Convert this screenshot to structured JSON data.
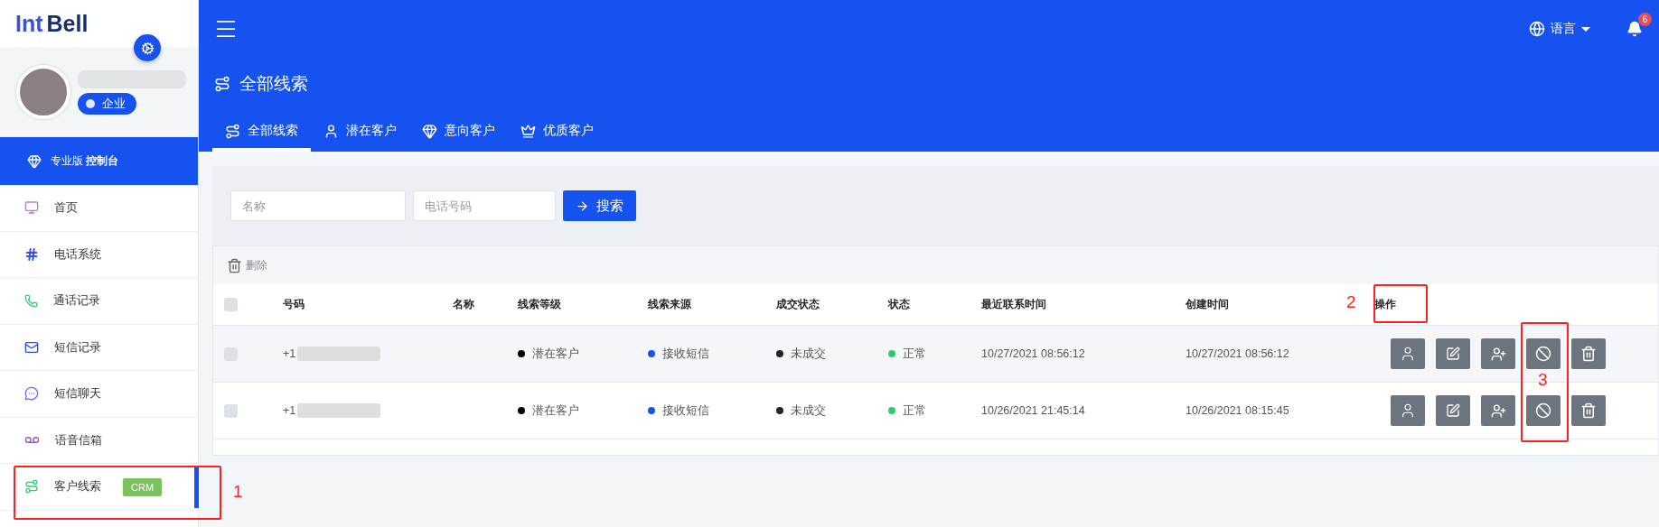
{
  "logo": {
    "part_1": "Int",
    "part_2": "Bell"
  },
  "profile": {
    "badge": "企业"
  },
  "console": {
    "label": "专业版 **控制台**"
  },
  "menu": [
    {
      "kind": "monitor",
      "label": "首页",
      "selected": false
    },
    {
      "kind": "hash",
      "label": "电话系统",
      "selected": false
    },
    {
      "kind": "phone",
      "label": "通话记录",
      "selected": false
    },
    {
      "kind": "mail",
      "label": "短信记录",
      "selected": false
    },
    {
      "kind": "chat",
      "label": "短信聊天",
      "selected": false
    },
    {
      "kind": "voicemail",
      "label": "语音信箱",
      "selected": false
    },
    {
      "kind": "route",
      "label": "客户线索",
      "selected": true,
      "badge": "CRM"
    }
  ],
  "header": {
    "language": "语言",
    "notifications": "6"
  },
  "page_title": "全部线索",
  "tabs": [
    {
      "kind": "route",
      "label": "全部线索",
      "selected": true
    },
    {
      "kind": "user",
      "label": "潜在客户",
      "selected": false
    },
    {
      "kind": "gem",
      "label": "意向客户",
      "selected": false
    },
    {
      "kind": "crown",
      "label": "优质客户",
      "selected": false
    }
  ],
  "search": {
    "name_placeholder": "名称",
    "phone_placeholder": "电话号码",
    "button": "搜索"
  },
  "toolbar": {
    "delete": "删除"
  },
  "table": {
    "columns": [
      "号码",
      "名称",
      "线索等级",
      "线索来源",
      "成交状态",
      "状态",
      "最近联系时间",
      "创建时间",
      "操作"
    ],
    "header_checked": false,
    "rows": [
      {
        "checked": false,
        "number": "+1",
        "grade": {
          "label": "潜在客户",
          "color": "#000000"
        },
        "source": {
          "label": "接收短信",
          "color": "#1652f0"
        },
        "deal": {
          "label": "未成交",
          "color": "#212529"
        },
        "status": {
          "label": "正常",
          "color": "#2ecc71"
        },
        "last_contact": "10/27/2021 08:56:12",
        "created": "10/27/2021 08:56:12"
      },
      {
        "checked": false,
        "number": "+1",
        "grade": {
          "label": "潜在客户",
          "color": "#000000"
        },
        "source": {
          "label": "接收短信",
          "color": "#1652f0"
        },
        "deal": {
          "label": "未成交",
          "color": "#212529"
        },
        "status": {
          "label": "正常",
          "color": "#2ecc71"
        },
        "last_contact": "10/26/2021 21:45:14",
        "created": "10/26/2021 08:15:45"
      }
    ]
  },
  "annotations": [
    {
      "label": "1"
    },
    {
      "label": "2"
    },
    {
      "label": "3"
    }
  ]
}
